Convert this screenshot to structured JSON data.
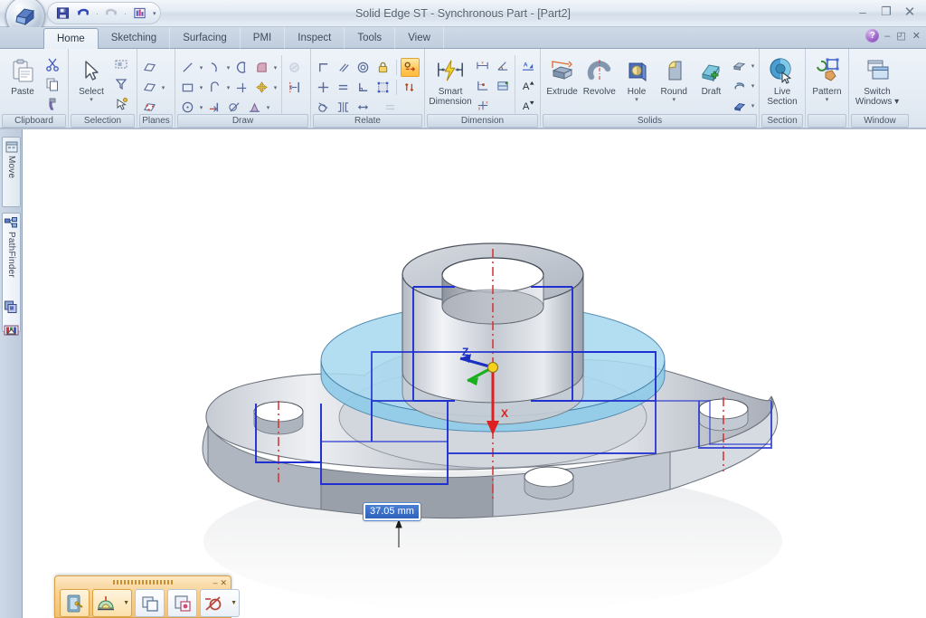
{
  "window": {
    "title": "Solid Edge ST - Synchronous Part - [Part2]",
    "controls": {
      "minimize": "–",
      "restore": "❐",
      "close": "✕"
    }
  },
  "quick_access": {
    "buttons": [
      {
        "name": "save-button",
        "icon": "save-icon",
        "enabled": true
      },
      {
        "name": "undo-button",
        "icon": "undo-icon",
        "enabled": true
      },
      {
        "name": "redo-button",
        "icon": "redo-icon",
        "enabled": false
      },
      {
        "name": "properties-button",
        "icon": "properties-icon",
        "enabled": true
      }
    ],
    "customize_arrow": "▾"
  },
  "tabs": [
    {
      "label": "Home",
      "active": true
    },
    {
      "label": "Sketching",
      "active": false
    },
    {
      "label": "Surfacing",
      "active": false
    },
    {
      "label": "PMI",
      "active": false
    },
    {
      "label": "Inspect",
      "active": false
    },
    {
      "label": "Tools",
      "active": false
    },
    {
      "label": "View",
      "active": false
    }
  ],
  "tab_row_right": {
    "help_label": "?",
    "doc_minimize": "–",
    "doc_restore": "◰",
    "doc_close": "✕"
  },
  "ribbon": {
    "groups": [
      {
        "label": "Clipboard",
        "big_buttons": [
          {
            "label": "Paste",
            "icon": "paste-icon",
            "arrow": ""
          }
        ],
        "small_buttons": [
          {
            "icon": "cut-icon",
            "arrow": ""
          },
          {
            "icon": "copy-icon",
            "arrow": ""
          },
          {
            "icon": "format-painter-icon",
            "arrow": ""
          }
        ]
      },
      {
        "label": "Selection",
        "big_buttons": [
          {
            "label": "Select",
            "icon": "select-arrow-icon",
            "arrow": "▾"
          }
        ],
        "small_buttons": [
          {
            "icon": "select-window-icon",
            "arrow": ""
          },
          {
            "icon": "select-filter-icon",
            "arrow": ""
          },
          {
            "icon": "select-similar-icon",
            "arrow": ""
          }
        ]
      },
      {
        "label": "Planes",
        "small_buttons": [
          {
            "icon": "coincident-plane-icon",
            "arrow": ""
          },
          {
            "icon": "parallel-plane-icon",
            "arrow": "▾"
          },
          {
            "icon": "plane-by-3-points-icon",
            "arrow": ""
          }
        ]
      },
      {
        "label": "Draw",
        "small_buttons": [
          {
            "icon": "line-icon",
            "arrow": "▾"
          },
          {
            "icon": "arc-icon",
            "arrow": "▾"
          },
          {
            "icon": "curve-icon",
            "arrow": ""
          },
          {
            "icon": "fillet-icon",
            "arrow": "▾"
          },
          {
            "icon": "rectangle-icon",
            "arrow": "▾"
          },
          {
            "icon": "tangent-arc-icon",
            "arrow": "▾"
          },
          {
            "icon": "trim-icon",
            "arrow": ""
          },
          {
            "icon": "move-entity-icon",
            "arrow": "▾"
          },
          {
            "icon": "circle-icon",
            "arrow": "▾"
          },
          {
            "icon": "offset-icon",
            "arrow": ""
          },
          {
            "icon": "mirror-icon",
            "arrow": ""
          },
          {
            "icon": "project-curve-icon",
            "arrow": "▾"
          },
          {
            "icon": "region-icon",
            "arrow": ""
          },
          {
            "icon": "symmetry-map-icon",
            "arrow": ""
          }
        ]
      },
      {
        "label": "Relate",
        "small_buttons": [
          {
            "icon": "connect-icon",
            "arrow": ""
          },
          {
            "icon": "parallel-icon",
            "arrow": ""
          },
          {
            "icon": "concentric-icon",
            "arrow": ""
          },
          {
            "icon": "lock-icon",
            "arrow": ""
          },
          {
            "icon": "maintain-relationships-icon",
            "arrow": "",
            "active": true
          },
          {
            "icon": "horizontal-vertical-icon",
            "arrow": ""
          },
          {
            "icon": "equal-icon",
            "arrow": ""
          },
          {
            "icon": "perpendicular-icon",
            "arrow": ""
          },
          {
            "icon": "relationship-handles-icon",
            "arrow": ""
          },
          {
            "icon": "live-rules-icon",
            "arrow": ""
          },
          {
            "icon": "tangent-icon",
            "arrow": ""
          },
          {
            "icon": "symmetric-icon",
            "arrow": ""
          },
          {
            "icon": "collinear-icon",
            "arrow": ""
          },
          {
            "icon": "relationship-assistant-icon",
            "arrow": "",
            "disabled": true
          }
        ]
      },
      {
        "label": "Dimension",
        "big_buttons": [
          {
            "label": "Smart\nDimension",
            "icon": "smart-dimension-icon",
            "arrow": ""
          }
        ],
        "small_buttons": [
          {
            "icon": "distance-between-icon",
            "arrow": ""
          },
          {
            "icon": "angle-between-icon",
            "arrow": ""
          },
          {
            "icon": "coordinate-dimension-icon",
            "arrow": ""
          },
          {
            "icon": "symmetric-diameter-icon",
            "arrow": ""
          },
          {
            "icon": "dimension-axis-icon",
            "arrow": ""
          },
          {
            "icon": "dimension-prefix-icon",
            "arrow": ""
          },
          {
            "icon": "font-increase-icon",
            "arrow": ""
          },
          {
            "icon": "font-decrease-icon",
            "arrow": ""
          }
        ]
      },
      {
        "label": "Solids",
        "big_buttons": [
          {
            "label": "Extrude",
            "icon": "extrude-icon",
            "arrow": ""
          },
          {
            "label": "Revolve",
            "icon": "revolve-icon",
            "arrow": ""
          },
          {
            "label": "Hole",
            "icon": "hole-icon",
            "arrow": "▾"
          },
          {
            "label": "Round",
            "icon": "round-icon",
            "arrow": "▾"
          },
          {
            "label": "Draft",
            "icon": "draft-icon",
            "arrow": ""
          }
        ],
        "small_buttons": [
          {
            "icon": "thin-wall-icon",
            "arrow": "▾"
          },
          {
            "icon": "helix-icon",
            "arrow": "▾"
          },
          {
            "icon": "sweep-icon",
            "arrow": "▾"
          }
        ]
      },
      {
        "label": "Section",
        "big_buttons": [
          {
            "label": "Live\nSection",
            "icon": "live-section-icon",
            "arrow": ""
          }
        ]
      },
      {
        "label": "",
        "big_buttons": [
          {
            "label": "Pattern",
            "icon": "pattern-icon",
            "arrow": "▾"
          }
        ]
      },
      {
        "label": "Window",
        "big_buttons": [
          {
            "label": "Switch\nWindows ▾",
            "icon": "switch-windows-icon",
            "arrow": ""
          }
        ]
      }
    ]
  },
  "left_dock": {
    "tabs": [
      {
        "label": "Move",
        "icon": "move-panel-icon"
      },
      {
        "label": "PathFinder",
        "icon": "pathfinder-icon"
      }
    ],
    "extra_icons": [
      {
        "name": "layers-icon"
      },
      {
        "name": "sensors-icon"
      }
    ]
  },
  "viewport": {
    "dimension_callout": {
      "value": "37.05 mm",
      "selected": true
    },
    "triad": {
      "x_label": "X",
      "y_label": "",
      "z_label": "Z",
      "x_color": "#e02020",
      "y_color": "#18b01c",
      "z_color": "#1a2ec0"
    },
    "colors": {
      "background": "#ffffff",
      "part_face": "#c9ced6",
      "section_plane": "#a8d7ef",
      "selection_edge": "#2030d0",
      "axis": "#d03030"
    }
  },
  "float_toolbar": {
    "buttons": [
      {
        "name": "select-tool-button",
        "icon": "select-tool-icon",
        "active": true,
        "has_arrow": false
      },
      {
        "name": "sketch-view-button",
        "icon": "sketch-view-icon",
        "active": true,
        "has_arrow": true
      },
      {
        "name": "copy-sketch-button",
        "icon": "copy-sketch-icon",
        "active": false,
        "has_arrow": false
      },
      {
        "name": "paste-sketch-button",
        "icon": "paste-sketch-icon",
        "active": false,
        "has_arrow": false
      },
      {
        "name": "dimension-tool-button",
        "icon": "dimension-tool-icon",
        "active": false,
        "has_arrow": true
      }
    ],
    "controls": {
      "minimize": "–",
      "close": "✕"
    }
  }
}
